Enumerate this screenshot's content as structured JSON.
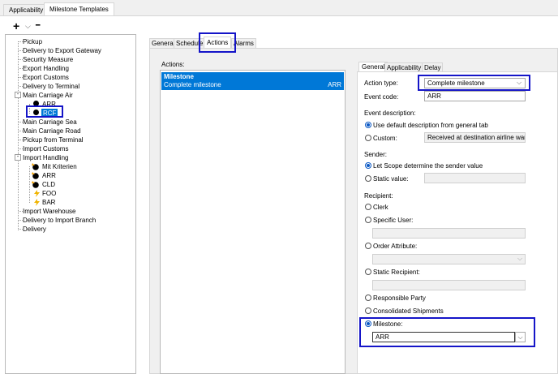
{
  "top_tabs": [
    "Applicability",
    "Milestone Templates"
  ],
  "toolbar": {
    "add_symbol": "+",
    "add_dropdown": "⌵",
    "remove_symbol": "━"
  },
  "tree": {
    "pickup": "Pickup",
    "delivery_export_gateway": "Delivery to Export Gateway",
    "security_measure": "Security Measure",
    "export_handling": "Export Handling",
    "export_customs": "Export Customs",
    "delivery_terminal": "Delivery to Terminal",
    "main_carriage_air": "Main Carriage Air",
    "air_arr": "ARR",
    "air_rcf": "RCF",
    "main_carriage_sea": "Main Carriage Sea",
    "main_carriage_road": "Main Carriage Road",
    "pickup_terminal": "Pickup from Terminal",
    "import_customs": "Import Customs",
    "import_handling": "Import Handling",
    "mit_kriterien": "Mit Kriterien",
    "imp_arr": "ARR",
    "imp_cld": "CLD",
    "imp_foo": "FOO",
    "imp_bar": "BAR",
    "import_warehouse": "Import Warehouse",
    "delivery_import_branch": "Delivery to Import Branch",
    "delivery": "Delivery"
  },
  "detail_tabs": [
    "General",
    "Schedule",
    "Actions",
    "Alarms"
  ],
  "actions": {
    "label": "Actions:",
    "item_title": "Milestone",
    "item_desc": "Complete milestone",
    "item_code": "ARR"
  },
  "action_tabs": [
    "General",
    "Applicability",
    "Delay"
  ],
  "form": {
    "action_type_label": "Action type:",
    "action_type_value": "Complete milestone",
    "event_code_label": "Event code:",
    "event_code_value": "ARR",
    "event_desc_label": "Event description:",
    "use_default_label": "Use default description from general tab",
    "custom_label": "Custom:",
    "custom_value": "Received at destination airline wareh",
    "sender_label": "Sender:",
    "let_scope_label": "Let Scope determine the sender value",
    "static_value_label": "Static value:",
    "recipient_label": "Recipient:",
    "clerk_label": "Clerk",
    "specific_user_label": "Specific User:",
    "order_attribute_label": "Order Attribute:",
    "static_recipient_label": "Static Recipient:",
    "responsible_party_label": "Responsible Party",
    "consolidated_label": "Consolidated Shipments",
    "milestone_label": "Milestone:",
    "milestone_value": "ARR"
  },
  "colors": {
    "selection": "#0078d7",
    "highlight": "#1515c8",
    "radio_on": "#0a58c4"
  }
}
